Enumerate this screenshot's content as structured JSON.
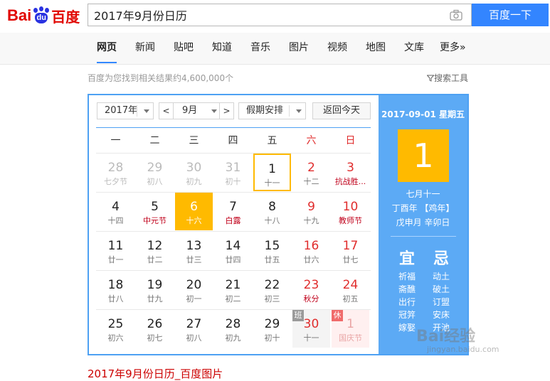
{
  "header": {
    "logo_text_left": "Bai",
    "logo_paw_text": "du",
    "logo_text_right": "百度",
    "search_value": "2017年9月份日历",
    "search_button": "百度一下"
  },
  "nav": {
    "items": [
      "网页",
      "新闻",
      "贴吧",
      "知道",
      "音乐",
      "图片",
      "视频",
      "地图",
      "文库",
      "更多»"
    ],
    "active": "网页"
  },
  "result_info": "百度为您找到相关结果约4,600,000个",
  "search_tools": "搜索工具",
  "calendar": {
    "year_select": "2017年",
    "month_select": "9月",
    "prev_month": "<",
    "next_month": ">",
    "holiday_select": "假期安排",
    "today_button": "返回今天",
    "weekdays": [
      "一",
      "二",
      "三",
      "四",
      "五",
      "六",
      "日"
    ],
    "weeks": [
      [
        {
          "d": "28",
          "l": "七夕节",
          "other": true
        },
        {
          "d": "29",
          "l": "初八",
          "other": true
        },
        {
          "d": "30",
          "l": "初九",
          "other": true
        },
        {
          "d": "31",
          "l": "初十",
          "other": true
        },
        {
          "d": "1",
          "l": "十一",
          "today": true
        },
        {
          "d": "2",
          "l": "十二",
          "wkend": true
        },
        {
          "d": "3",
          "l": "抗战胜...",
          "wkend": true,
          "festival": true
        }
      ],
      [
        {
          "d": "4",
          "l": "十四"
        },
        {
          "d": "5",
          "l": "中元节",
          "festival": true
        },
        {
          "d": "6",
          "l": "十六",
          "selected": true
        },
        {
          "d": "7",
          "l": "白露",
          "festival": true
        },
        {
          "d": "8",
          "l": "十八"
        },
        {
          "d": "9",
          "l": "十九",
          "wkend": true
        },
        {
          "d": "10",
          "l": "教师节",
          "wkend": true,
          "festival": true
        }
      ],
      [
        {
          "d": "11",
          "l": "廿一"
        },
        {
          "d": "12",
          "l": "廿二"
        },
        {
          "d": "13",
          "l": "廿三"
        },
        {
          "d": "14",
          "l": "廿四"
        },
        {
          "d": "15",
          "l": "廿五"
        },
        {
          "d": "16",
          "l": "廿六",
          "wkend": true
        },
        {
          "d": "17",
          "l": "廿七",
          "wkend": true
        }
      ],
      [
        {
          "d": "18",
          "l": "廿八"
        },
        {
          "d": "19",
          "l": "廿九"
        },
        {
          "d": "20",
          "l": "初一"
        },
        {
          "d": "21",
          "l": "初二"
        },
        {
          "d": "22",
          "l": "初三"
        },
        {
          "d": "23",
          "l": "秋分",
          "wkend": true,
          "festival": true
        },
        {
          "d": "24",
          "l": "初五",
          "wkend": true
        }
      ],
      [
        {
          "d": "25",
          "l": "初六"
        },
        {
          "d": "26",
          "l": "初七"
        },
        {
          "d": "27",
          "l": "初八"
        },
        {
          "d": "28",
          "l": "初九"
        },
        {
          "d": "29",
          "l": "初十"
        },
        {
          "d": "30",
          "l": "十一",
          "wkend": true,
          "rest": true,
          "badge": "班"
        },
        {
          "d": "1",
          "l": "国庆节",
          "holiday": true,
          "badge": "休"
        }
      ]
    ],
    "panel": {
      "date_line": "2017-09-01 星期五",
      "big_day": "1",
      "lunar": "七月十一",
      "ganzhi_year": "丁酉年 【鸡年】",
      "ganzhi_month_day": "戊申月 辛卯日",
      "yi_label": "宜",
      "ji_label": "忌",
      "yi": [
        "祈福",
        "斋醮",
        "出行",
        "冠笄",
        "嫁娶"
      ],
      "ji": [
        "动土",
        "破土",
        "订盟",
        "安床",
        "开池"
      ]
    }
  },
  "sub_link": "2017年9月份日历_百度图片",
  "watermark": "Bai经验",
  "watermark_sub": "jingyan.baidu.com",
  "colors": {
    "accent_blue": "#3385ff",
    "calendar_border": "#4ea1f3",
    "panel_blue": "#5caaf5",
    "highlight": "#ffba00",
    "weekend_red": "#e02d2d"
  }
}
